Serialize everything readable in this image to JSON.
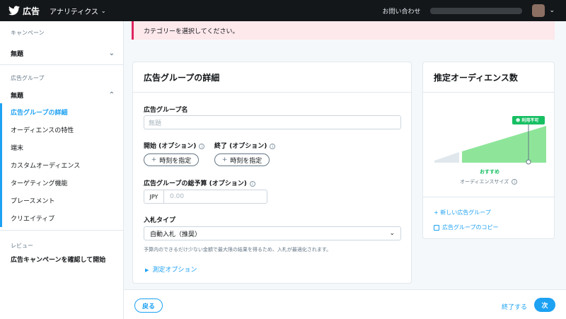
{
  "header": {
    "brand": "広告",
    "analytics": "アナリティクス",
    "contact": "お問い合わせ"
  },
  "sidebar": {
    "campaign_title": "キャンペーン",
    "campaign_name": "無題",
    "adgroup_title": "広告グループ",
    "adgroup_name": "無題",
    "items": [
      {
        "label": "広告グループの詳細",
        "active": true
      },
      {
        "label": "オーディエンスの特性"
      },
      {
        "label": "端末"
      },
      {
        "label": "カスタムオーディエンス"
      },
      {
        "label": "ターゲティング機能"
      },
      {
        "label": "プレースメント"
      },
      {
        "label": "クリエイティブ"
      }
    ],
    "review_title": "レビュー",
    "review_link": "広告キャンペーンを確認して開始"
  },
  "alert": {
    "text": "カテゴリーを選択してください。"
  },
  "detail": {
    "title": "広告グループの詳細",
    "name_label": "広告グループ名",
    "name_placeholder": "無題",
    "start_label": "開始 (オプション)",
    "end_label": "終了 (オプション)",
    "time_button": "時刻を指定",
    "budget_label": "広告グループの総予算 (オプション)",
    "currency": "JPY",
    "budget_placeholder": "0.00",
    "bid_label": "入札タイプ",
    "bid_value": "自動入札（推奨）",
    "bid_help": "予算内のできるだけ少ない金額で最大限の結果を得るため、入札が最適化されます。",
    "measure_link": "測定オプション"
  },
  "audience": {
    "title": "推定オーディエンス数",
    "badge": "利用不可",
    "recommended": "おすすめ",
    "size_label": "オーディエンスサイズ",
    "new_group": "新しい広告グループ",
    "copy_group": "広告グループのコピー",
    "colors": {
      "green": "#8ee59a",
      "green_dark": "#17bf63",
      "gray": "#e1e8ed"
    }
  },
  "footer": {
    "back": "戻る",
    "finish": "終了する",
    "next": "次"
  }
}
